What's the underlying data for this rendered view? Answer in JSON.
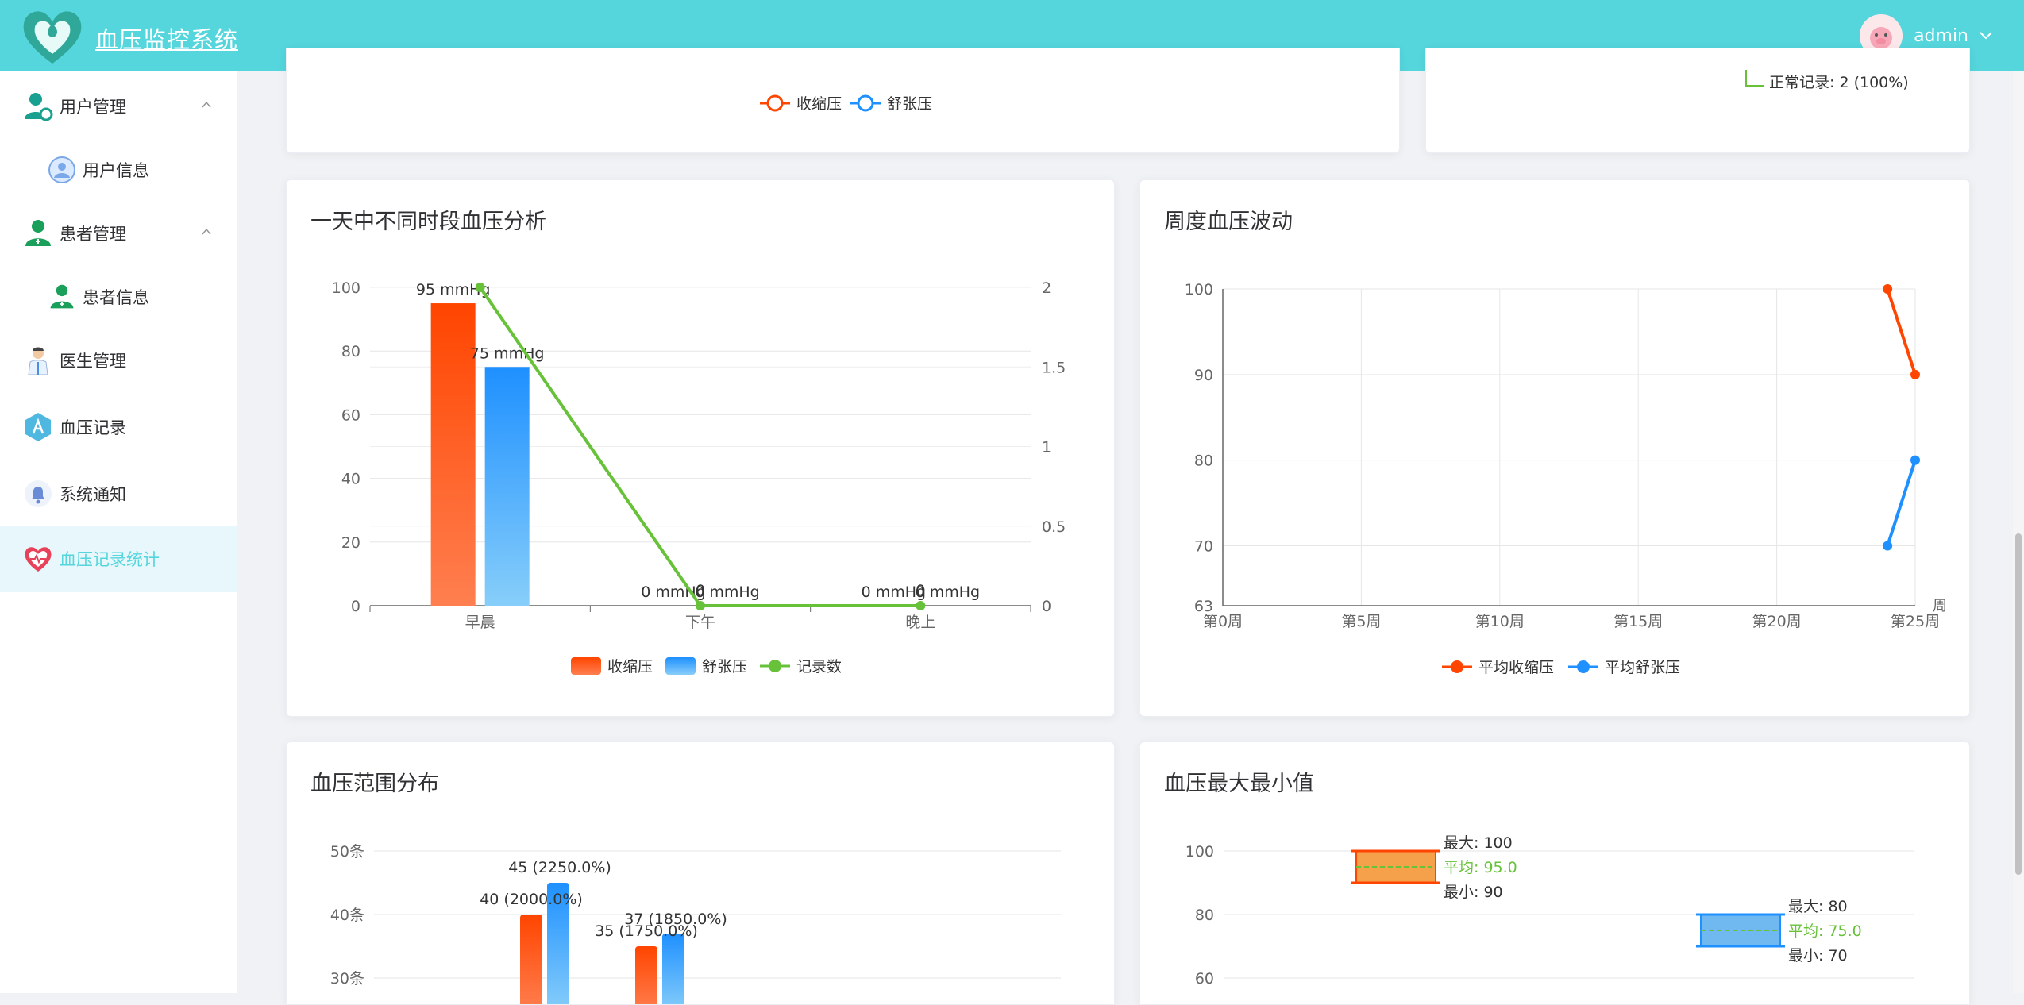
{
  "header": {
    "title": "血压监控系统",
    "username": "admin"
  },
  "sidebar": {
    "items": [
      {
        "label": "用户管理"
      },
      {
        "label": "用户信息"
      },
      {
        "label": "患者管理"
      },
      {
        "label": "患者信息"
      },
      {
        "label": "医生管理"
      },
      {
        "label": "血压记录"
      },
      {
        "label": "系统通知"
      },
      {
        "label": "血压记录统计"
      }
    ]
  },
  "top_cards": {
    "legend": [
      "收缩压",
      "舒张压"
    ],
    "right_note": "正常记录: 2 (100%)"
  },
  "colors": {
    "systolic": "#ff4500",
    "diastolic": "#1e90ff",
    "count": "#67c23a",
    "accent": "#54d6dc"
  },
  "cards": {
    "period": {
      "title": "一天中不同时段血压分析"
    },
    "weekly": {
      "title": "周度血压波动"
    },
    "range": {
      "title": "血压范围分布"
    },
    "maxmin": {
      "title": "血压最大最小值"
    }
  },
  "chart_data": [
    {
      "id": "period",
      "type": "bar",
      "categories": [
        "早晨",
        "下午",
        "晚上"
      ],
      "series": [
        {
          "name": "收缩压",
          "values": [
            95,
            0,
            0
          ],
          "labels": [
            "95 mmHg",
            "0 mmHg",
            "0 mmHg"
          ]
        },
        {
          "name": "舒张压",
          "values": [
            75,
            0,
            0
          ],
          "labels": [
            "75 mmHg",
            "0 mmHg",
            "0 mmHg"
          ]
        },
        {
          "name": "记录数",
          "type": "line",
          "axis": "right",
          "values": [
            2,
            0,
            0
          ],
          "labels": [
            "",
            "0",
            "0"
          ]
        }
      ],
      "ylim": [
        0,
        100
      ],
      "yticks": [
        "0",
        "20",
        "40",
        "60",
        "80",
        "100"
      ],
      "y2lim": [
        0,
        2
      ],
      "y2ticks": [
        "0",
        "0.5",
        "1",
        "1.5",
        "2"
      ]
    },
    {
      "id": "weekly",
      "type": "line",
      "xlim": [
        0,
        25
      ],
      "xticks": [
        "第0周",
        "第5周",
        "第10周",
        "第15周",
        "第20周",
        "第25周"
      ],
      "xlabel": "周",
      "ylim": [
        63,
        100
      ],
      "yticks": [
        "63",
        "70",
        "80",
        "90",
        "100"
      ],
      "series": [
        {
          "name": "平均收缩压",
          "x": [
            24,
            25
          ],
          "values": [
            100,
            90
          ]
        },
        {
          "name": "平均舒张压",
          "x": [
            24,
            25
          ],
          "values": [
            70,
            80
          ]
        }
      ]
    },
    {
      "id": "range",
      "type": "bar",
      "yticks": [
        "30条",
        "40条",
        "50条"
      ],
      "ylim": [
        30,
        50
      ],
      "series": [
        {
          "name": "收缩压",
          "values": [
            40,
            35
          ],
          "labels": [
            "40 (2000.0%)",
            "35 (1750.0%)"
          ]
        },
        {
          "name": "舒张压",
          "values": [
            45,
            37
          ],
          "labels": [
            "45 (2250.0%)",
            "37 (1850.0%)"
          ]
        }
      ]
    },
    {
      "id": "maxmin",
      "type": "box",
      "yticks": [
        "60",
        "80",
        "100"
      ],
      "ylim": [
        60,
        100
      ],
      "series": [
        {
          "name": "收缩压",
          "max": 100,
          "avg": 95.0,
          "min": 90,
          "max_label": "最大: 100",
          "avg_label": "平均: 95.0",
          "min_label": "最小: 90"
        },
        {
          "name": "舒张压",
          "max": 80,
          "avg": 75.0,
          "min": 70,
          "max_label": "最大: 80",
          "avg_label": "平均: 75.0",
          "min_label": "最小: 70"
        }
      ]
    }
  ]
}
